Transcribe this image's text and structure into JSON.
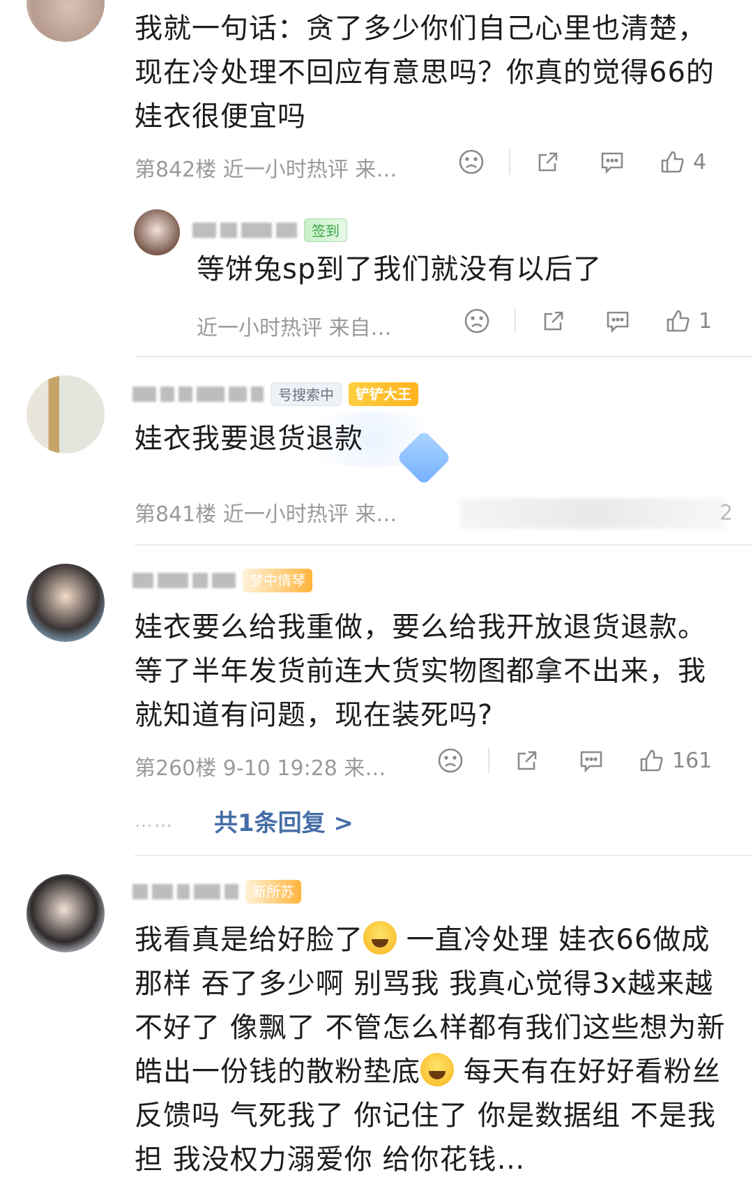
{
  "comments": [
    {
      "text": "我就一句话：贪了多少你们自己心里也清楚，现在冷处理不回应有意思吗？你真的觉得66的娃衣很便宜吗",
      "meta": "第842楼  近一小时热评  来…",
      "likes": "4",
      "reply": {
        "badge": "签到",
        "text": "等饼兔sp到了我们就没有以后了",
        "meta": "近一小时热评  来自…",
        "likes": "1"
      }
    },
    {
      "badge1": "号搜索中",
      "badge2": "铲铲大王",
      "text": "娃衣我要退货退款",
      "meta": "第841楼  近一小时热评  来…",
      "likes": "2"
    },
    {
      "badge": "梦中情琴",
      "text": "娃衣要么给我重做，要么给我开放退货退款。等了半年发货前连大货实物图都拿不出来，我就知道有问题，现在装死吗?",
      "meta": "第260楼  9-10 19:28  来…",
      "likes": "161",
      "more_replies_dots": "……",
      "more_replies": "共1条回复 >"
    },
    {
      "badge": "新所苏",
      "text_parts": [
        "我看真是给好脸了",
        " 一直冷处理 娃衣66做成那样 吞了多少啊 别骂我 我真心觉得3x越来越不好了 像飘了 不管怎么样都有我们这些想为新皓出一份钱的散粉垫底",
        " 每天有在好好看粉丝反馈吗 气死我了 你记住了 你是数据组 不是我担 我没权力溺爱你 给你花钱…"
      ]
    }
  ],
  "icons": {
    "dislike": "sad-face-icon",
    "share": "share-icon",
    "reply": "comment-icon",
    "like": "thumbs-up-icon"
  }
}
